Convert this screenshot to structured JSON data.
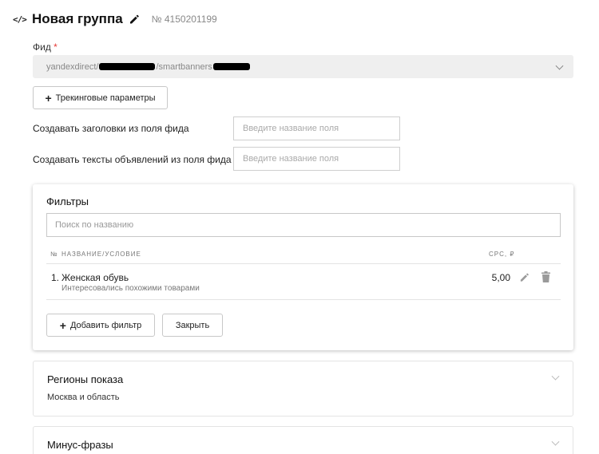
{
  "header": {
    "code_icon": "</>",
    "title": "Новая группа",
    "number": "№ 4150201199"
  },
  "feed": {
    "label": "Фид",
    "required_mark": "*",
    "value_prefix": "yandexdirect/",
    "value_middle": "/smartbanners"
  },
  "tracking_button": {
    "label": "Трекинговые параметры"
  },
  "fields": [
    {
      "label": "Создавать заголовки из поля фида",
      "placeholder": "Введите название поля"
    },
    {
      "label": "Создавать тексты объявлений из поля фида",
      "placeholder": "Введите название поля"
    }
  ],
  "filters": {
    "title": "Фильтры",
    "search_placeholder": "Поиск по названию",
    "columns": {
      "num": "№",
      "name": "НАЗВАНИЕ/УСЛОВИЕ",
      "cpc": "CPC, ₽"
    },
    "rows": [
      {
        "num": "1.",
        "name": "Женская обувь",
        "condition": "Интересовались похожими товарами",
        "cpc": "5,00"
      }
    ],
    "add_button": "Добавить фильтр",
    "close_button": "Закрыть"
  },
  "regions": {
    "title": "Регионы показа",
    "value": "Москва и область"
  },
  "minus_phrases": {
    "title": "Минус-фразы"
  },
  "colors": {
    "required": "#e53935",
    "select_bg": "#efefef"
  }
}
